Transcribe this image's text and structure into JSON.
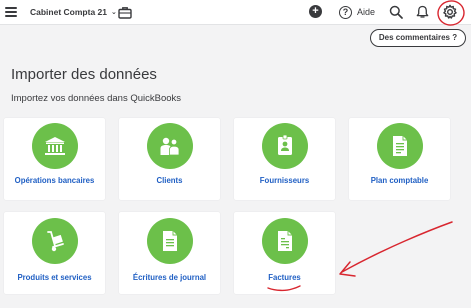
{
  "topbar": {
    "menu_icon": "hamburger-icon",
    "company_name": "Cabinet Compta 21",
    "company_chevron": "⌄",
    "briefcase_icon": "briefcase-icon",
    "plus_icon": "plus-icon",
    "plus_glyph": "+",
    "help_glyph": "?",
    "help_label": "Aide",
    "search_icon": "search-icon",
    "bell_icon": "bell-icon",
    "settings_icon": "gear-icon"
  },
  "feedback_button": "Des commentaires ?",
  "page": {
    "title": "Importer des données",
    "subtitle": "Importez vos données dans QuickBooks"
  },
  "cards": [
    {
      "label": "Opérations bancaires",
      "icon": "bank-icon"
    },
    {
      "label": "Clients",
      "icon": "people-icon"
    },
    {
      "label": "Fournisseurs",
      "icon": "supplier-badge-icon"
    },
    {
      "label": "Plan comptable",
      "icon": "document-list-icon"
    },
    {
      "label": "Produits et services",
      "icon": "hand-truck-icon"
    },
    {
      "label": "Écritures de journal",
      "icon": "journal-icon"
    },
    {
      "label": "Factures",
      "icon": "invoice-icon"
    }
  ],
  "colors": {
    "accent_green": "#6cc04a",
    "link_blue": "#2160c4",
    "text_dark": "#393a3d",
    "page_bg": "#f3f3f4",
    "annotation_red": "#d8262f"
  }
}
